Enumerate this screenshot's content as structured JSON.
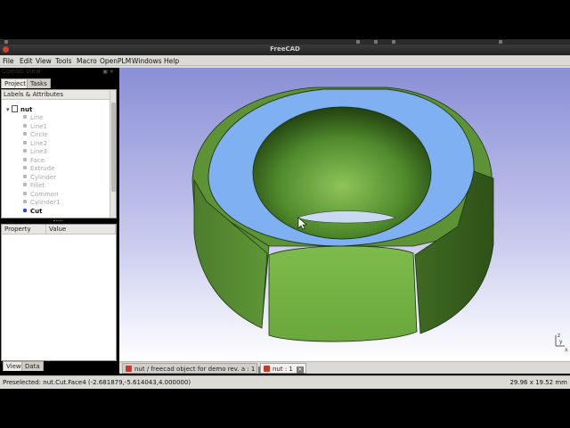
{
  "window": {
    "title": "FreeCAD"
  },
  "menu": [
    "File",
    "Edit",
    "View",
    "Tools",
    "Macro",
    "OpenPLM",
    "Windows",
    "Help"
  ],
  "combo_view": {
    "title": "Combo View",
    "tabs": [
      "Project",
      "Tasks"
    ],
    "tree_header": "Labels & Attributes",
    "root": "nut",
    "items": [
      "Line",
      "Line1",
      "Circle",
      "Line2",
      "Line3",
      "Face",
      "Extrude",
      "Cylinder",
      "Fillet",
      "Common",
      "Cylinder1",
      "Cut"
    ],
    "active_item": "Cut",
    "property_columns": [
      "Property",
      "Value"
    ],
    "bottom_tabs": [
      "View",
      "Data"
    ]
  },
  "doc_tabs": [
    "nut / freecad object for demo rev. a : 1",
    "nut : 1"
  ],
  "status": {
    "message": "Preselected: nut.Cut.Face4 (-2.681879,-5.614043,4.000000)",
    "dimensions": "29.96 x 19.52 mm"
  },
  "axis": {
    "x": "x",
    "y": "y",
    "z": "z"
  },
  "colors": {
    "viewport_top": "#8a8fd6",
    "viewport_bottom": "#ffffff",
    "nut_body": "#6ba33f",
    "nut_selected": "#7fb0f2"
  }
}
